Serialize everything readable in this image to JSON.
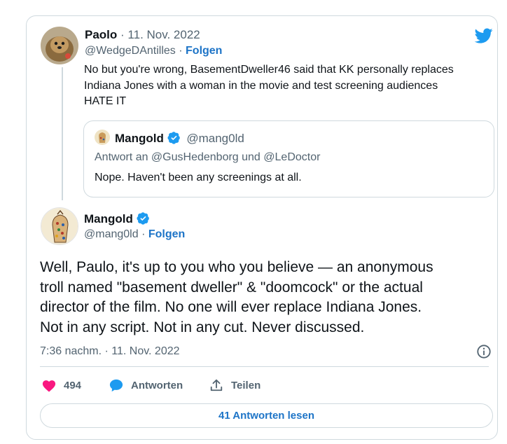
{
  "reply_tweet": {
    "author_name": "Paolo",
    "date": "· 11. Nov. 2022",
    "handle": "@WedgeDAntilles ·",
    "follow": "Folgen",
    "text_lines": [
      "No but you're wrong, BasementDweller46 said that KK personally replaces",
      "Indiana Jones with a woman in the movie and test screening audiences",
      "HATE IT"
    ]
  },
  "quoted_tweet": {
    "author_name": "Mangold",
    "handle": "@mang0ld",
    "reply_to": "Antwort an @GusHedenborg und @LeDoctor",
    "text": "Nope. Haven't been any screenings at all."
  },
  "main_tweet": {
    "author_name": "Mangold",
    "handle": "@mang0ld ·",
    "follow": "Folgen",
    "text_lines": [
      "Well, Paulo, it's up to you who you believe — an anonymous",
      "troll named \"basement dweller\" & \"doomcock\" or the actual",
      "director of the film. No one will ever replace Indiana Jones.",
      "Not in any script. Not in any cut. Never discussed."
    ],
    "timestamp": "7:36 nachm. · 11. Nov. 2022"
  },
  "actions": {
    "likes": "494",
    "reply_label": "Antworten",
    "share_label": "Teilen",
    "read_replies": "41 Antworten lesen"
  },
  "colors": {
    "link": "#1d74c7",
    "like": "#f91880",
    "verified": "#1d9bf0",
    "twitter": "#1d9bf0",
    "border": "#cfd9de"
  },
  "icons": [
    "twitter-bird-icon",
    "verified-icon",
    "heart-icon",
    "reply-bubble-icon",
    "share-icon",
    "info-icon"
  ]
}
